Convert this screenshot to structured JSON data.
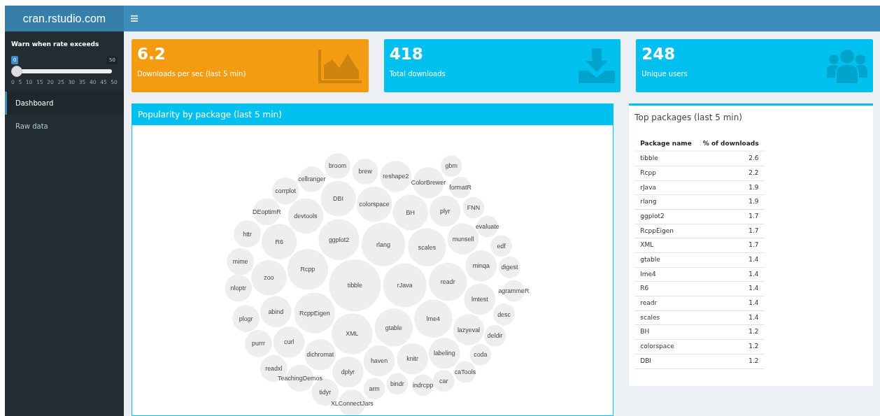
{
  "header": {
    "title": "cran.rstudio.com"
  },
  "sidebar": {
    "slider": {
      "label": "Warn when rate exceeds",
      "value": "0",
      "max_label": "50",
      "level": 0,
      "ticks": [
        "0",
        "5",
        "10",
        "15",
        "20",
        "25",
        "30",
        "35",
        "40",
        "45",
        "50"
      ]
    },
    "items": [
      {
        "label": "Dashboard",
        "selected": true
      },
      {
        "label": "Raw data",
        "selected": false
      }
    ]
  },
  "value_boxes": [
    {
      "value": "6.2",
      "label": "Downloads per sec (last 5 min)",
      "color": "#f39c12",
      "kind": "area"
    },
    {
      "value": "418",
      "label": "Total downloads",
      "color": "#00c0ef",
      "kind": "download"
    },
    {
      "value": "248",
      "label": "Unique users",
      "color": "#00c0ef",
      "kind": "users"
    }
  ],
  "bubble_box": {
    "title": "Popularity by package (last 5 min)",
    "bubbles": [
      {
        "label": "broom"
      },
      {
        "label": "brew"
      },
      {
        "label": "reshape2"
      },
      {
        "label": "ColorBrewer"
      },
      {
        "label": "gbm"
      },
      {
        "label": "formatR"
      },
      {
        "label": "cellranger"
      },
      {
        "label": "corrplot"
      },
      {
        "label": "DBI"
      },
      {
        "label": "colorspace"
      },
      {
        "label": "BH"
      },
      {
        "label": "plyr"
      },
      {
        "label": "FNN"
      },
      {
        "label": "DEoptimR"
      },
      {
        "label": "devtools"
      },
      {
        "label": "evaluate"
      },
      {
        "label": "httr"
      },
      {
        "label": "R6"
      },
      {
        "label": "ggplot2"
      },
      {
        "label": "rlang"
      },
      {
        "label": "scales"
      },
      {
        "label": "munsell"
      },
      {
        "label": "edf"
      },
      {
        "label": "mime"
      },
      {
        "label": "zoo"
      },
      {
        "label": "Rcpp"
      },
      {
        "label": "tibble"
      },
      {
        "label": "rJava"
      },
      {
        "label": "readr"
      },
      {
        "label": "minqa"
      },
      {
        "label": "digest"
      },
      {
        "label": "nloptr"
      },
      {
        "label": "agrammeR"
      },
      {
        "label": "lmtest"
      },
      {
        "label": "abind"
      },
      {
        "label": "RcppEigen"
      },
      {
        "label": "XML"
      },
      {
        "label": "gtable"
      },
      {
        "label": "lme4"
      },
      {
        "label": "desc"
      },
      {
        "label": "plogr"
      },
      {
        "label": "lazyeval"
      },
      {
        "label": "deldir"
      },
      {
        "label": "purrr"
      },
      {
        "label": "curl"
      },
      {
        "label": "dichromat"
      },
      {
        "label": "haven"
      },
      {
        "label": "knitr"
      },
      {
        "label": "labeling"
      },
      {
        "label": "coda"
      },
      {
        "label": "readxl"
      },
      {
        "label": "TeachingDemos"
      },
      {
        "label": "dplyr"
      },
      {
        "label": "arm"
      },
      {
        "label": "bindr"
      },
      {
        "label": "indrcpp"
      },
      {
        "label": "car"
      },
      {
        "label": "caTools"
      },
      {
        "label": "tidyr"
      },
      {
        "label": "XLConnectJars"
      }
    ]
  },
  "table_box": {
    "title": "Top packages (last 5 min)",
    "columns": [
      "Package name",
      "% of downloads"
    ],
    "rows": [
      [
        "tibble",
        "2.6"
      ],
      [
        "Rcpp",
        "2.2"
      ],
      [
        "rJava",
        "1.9"
      ],
      [
        "rlang",
        "1.9"
      ],
      [
        "ggplot2",
        "1.7"
      ],
      [
        "RcppEigen",
        "1.7"
      ],
      [
        "XML",
        "1.7"
      ],
      [
        "gtable",
        "1.4"
      ],
      [
        "lme4",
        "1.4"
      ],
      [
        "R6",
        "1.4"
      ],
      [
        "readr",
        "1.4"
      ],
      [
        "scales",
        "1.4"
      ],
      [
        "BH",
        "1.2"
      ],
      [
        "colorspace",
        "1.2"
      ],
      [
        "DBI",
        "1.2"
      ]
    ]
  }
}
